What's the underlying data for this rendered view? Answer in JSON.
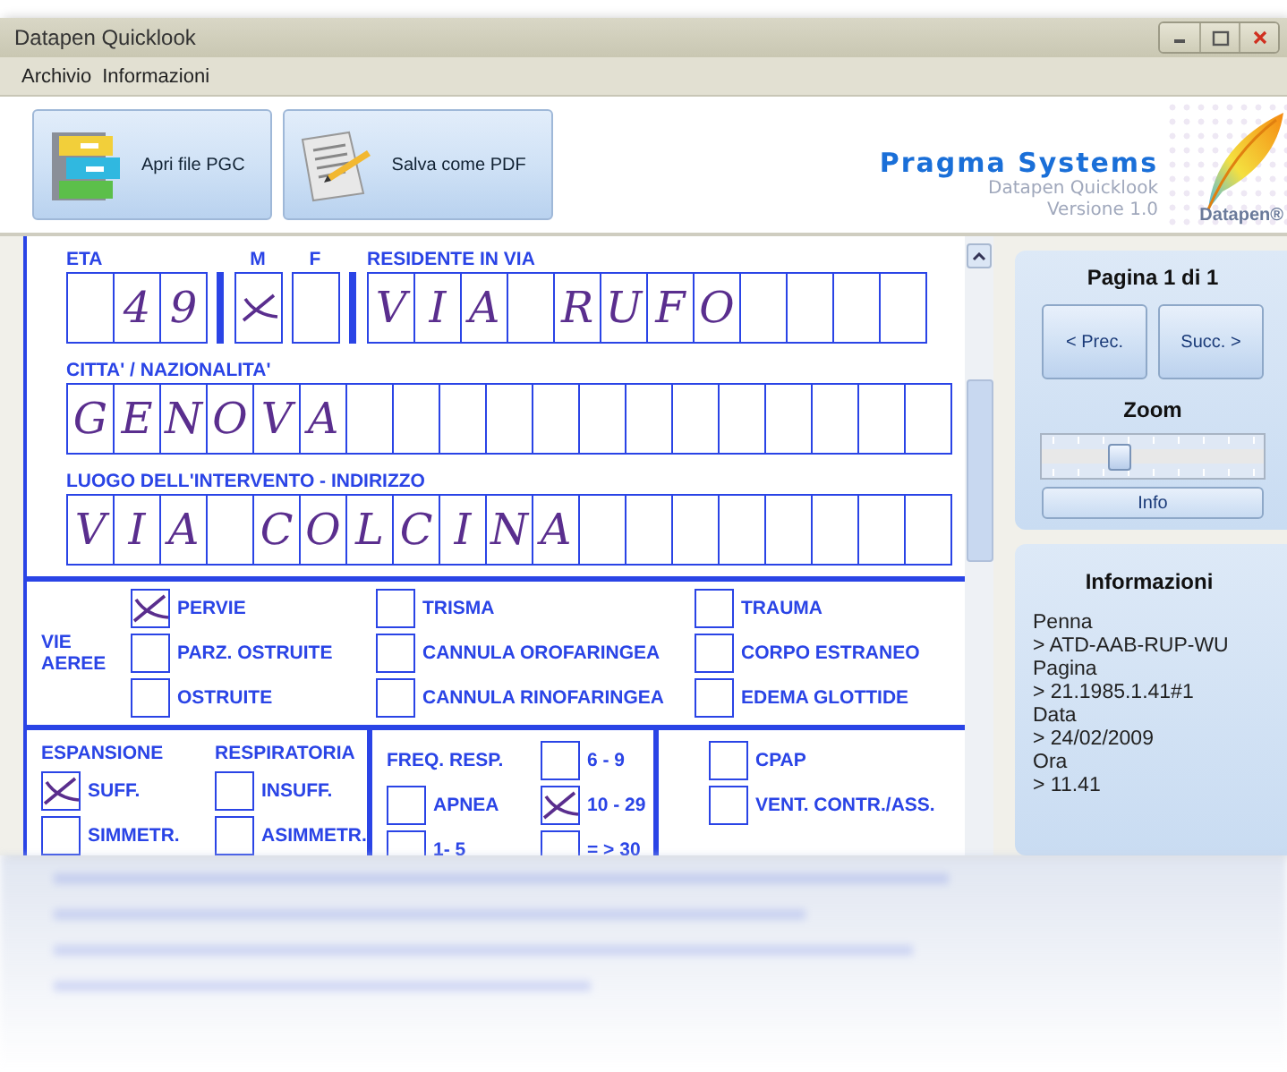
{
  "window": {
    "title": "Datapen Quicklook",
    "controls": [
      {
        "kind": "minimize"
      },
      {
        "kind": "maximize"
      },
      {
        "kind": "close"
      }
    ]
  },
  "menu": [
    "Archivio",
    "Informazioni"
  ],
  "toolbar": {
    "buttons": [
      {
        "kind": "open",
        "label": "Apri file PGC"
      },
      {
        "kind": "pdf",
        "label": "Salva come PDF"
      }
    ],
    "brand": {
      "company": "Pragma Systems",
      "product": "Datapen Quicklook",
      "version": "Versione 1.0",
      "logo_text": "Datapen®"
    }
  },
  "form": {
    "row1": [
      {
        "kind": "cells",
        "label": "ETA",
        "cells": [
          null,
          "4",
          "9"
        ]
      },
      {
        "kind": "bar"
      },
      {
        "kind": "check",
        "label": "M",
        "checked": true
      },
      {
        "kind": "check",
        "label": "F",
        "checked": false
      },
      {
        "kind": "bar"
      },
      {
        "kind": "cells",
        "label": "RESIDENTE IN VIA",
        "cells": [
          "V",
          "I",
          "A",
          null,
          "R",
          "U",
          "F",
          "O",
          null,
          null,
          null,
          null
        ]
      }
    ],
    "fields": [
      {
        "label": "CITTA'  / NAZIONALITA'",
        "cells": [
          "G",
          "E",
          "N",
          "O",
          "V",
          "A",
          null,
          null,
          null,
          null,
          null,
          null,
          null,
          null,
          null,
          null,
          null,
          null,
          null
        ]
      },
      {
        "label": "LUOGO DELL'INTERVENTO - INDIRIZZO",
        "cells": [
          "V",
          "I",
          "A",
          null,
          "C",
          "O",
          "L",
          "C",
          "I",
          "N",
          "A",
          null,
          null,
          null,
          null,
          null,
          null,
          null,
          null
        ]
      }
    ],
    "vie_aeree": {
      "title": "VIE AEREE",
      "columns": [
        [
          {
            "label": "PERVIE",
            "checked": true
          },
          {
            "label": "PARZ. OSTRUITE",
            "checked": false
          },
          {
            "label": "OSTRUITE",
            "checked": false
          }
        ],
        [
          {
            "label": "TRISMA",
            "checked": false
          },
          {
            "label": "CANNULA OROFARINGEA",
            "checked": false
          },
          {
            "label": "CANNULA RINOFARINGEA",
            "checked": false
          }
        ],
        [
          {
            "label": "TRAUMA",
            "checked": false
          },
          {
            "label": "CORPO ESTRANEO",
            "checked": false
          },
          {
            "label": "EDEMA GLOTTIDE",
            "checked": false
          }
        ]
      ]
    },
    "espansione": {
      "headings": [
        "ESPANSIONE",
        "RESPIRATORIA"
      ],
      "options": [
        {
          "label": "SUFF.",
          "checked": true
        },
        {
          "label": "INSUFF.",
          "checked": false
        },
        {
          "label": "SIMMETR.",
          "checked": false
        },
        {
          "label": "ASIMMETR.",
          "checked": false
        }
      ]
    },
    "freq_resp": {
      "heading": "FREQ. RESP.",
      "options": [
        {
          "label": "6 - 9",
          "checked": false
        },
        {
          "label": "APNEA",
          "checked": false
        },
        {
          "label": "10 - 29",
          "checked": true
        },
        {
          "label": "1- 5",
          "checked": false
        },
        {
          "label": "=  > 30",
          "checked": false
        }
      ]
    },
    "ventilazione": {
      "options": [
        {
          "label": "CPAP",
          "checked": false
        },
        {
          "label": "VENT. CONTR./ASS.",
          "checked": false
        }
      ]
    }
  },
  "navigation": {
    "page": "Pagina 1 di 1",
    "prev": "< Prec.",
    "next": "Succ. >",
    "zoom_label": "Zoom",
    "zoom": {
      "level": 0.33
    },
    "info_button": "Info"
  },
  "info": {
    "title": "Informazioni",
    "lines": [
      "Penna",
      "> ATD-AAB-RUP-WU",
      "Pagina",
      "> 21.1985.1.41#1",
      "Data",
      "> 24/02/2009",
      "Ora",
      "> 11.41"
    ]
  }
}
